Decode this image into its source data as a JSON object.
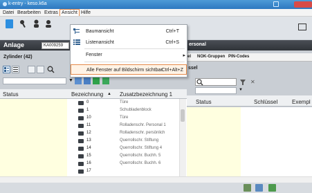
{
  "window": {
    "title": "k-entry - keso.k6a"
  },
  "menubar": {
    "items": [
      "Datei",
      "Bearbeiten",
      "Extras",
      "Ansicht",
      "Hilfe"
    ]
  },
  "ansicht_menu": {
    "items": [
      {
        "label": "Baumansicht",
        "shortcut": "Ctrl+T",
        "icon": "tree-view-icon"
      },
      {
        "label": "Listenansicht",
        "shortcut": "Ctrl+S",
        "icon": "list-view-icon"
      },
      {
        "label": "Fenster",
        "shortcut": "▸",
        "icon": ""
      },
      {
        "label": "Alle Fenster auf Bildschirm sichtbar",
        "shortcut": "Ctrl+Alt+Z",
        "icon": ""
      }
    ]
  },
  "left": {
    "header_label": "Anlage",
    "anlage_value": "KA009259",
    "zylinder_title": "Zylinder (42)",
    "columns": [
      "Status",
      "Bezeichnung",
      "Zusatzbezeichnung 1"
    ],
    "sort_indicator": "▲",
    "rows": [
      {
        "name": "0",
        "extra": "Türe"
      },
      {
        "name": "1",
        "extra": "Schubladenblock"
      },
      {
        "name": "10",
        "extra": "Türe"
      },
      {
        "name": "11",
        "extra": "Rolladenschr. Personal 1"
      },
      {
        "name": "12",
        "extra": "Rolladenschr. persönlich"
      },
      {
        "name": "13",
        "extra": "Querrollschr. Stiftung"
      },
      {
        "name": "14",
        "extra": "Querrollschr. Stiftung 4"
      },
      {
        "name": "15",
        "extra": "Querrollschr. Buchh. 5"
      },
      {
        "name": "16",
        "extra": "Querrollschr. Buchh. 6"
      },
      {
        "name": "17",
        "extra": ""
      }
    ]
  },
  "right": {
    "header_label": "ersonal",
    "tabs": [
      "el",
      "NOK-Gruppen",
      "PIN-Codes"
    ],
    "section_label": "ssel",
    "columns": [
      "Status",
      "Schlüssel",
      "Exempl"
    ]
  },
  "colors": {
    "menu_highlight_border": "#e58a4a",
    "header_dark": "#3a3e44",
    "status_column": "#ffffe0"
  }
}
